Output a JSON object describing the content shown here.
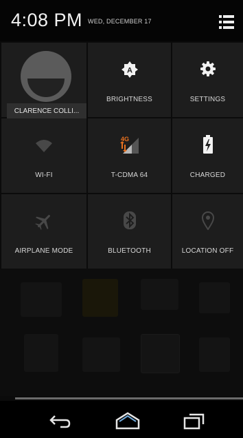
{
  "status": {
    "time": "4:08 PM",
    "date": "WED, DECEMBER 17"
  },
  "header": {
    "menu_icon": "list-menu-icon"
  },
  "tiles": {
    "user": {
      "label": "CLARENCE COLLI...",
      "icon": "avatar"
    },
    "brightness": {
      "label": "BRIGHTNESS",
      "icon": "brightness-auto-icon"
    },
    "settings": {
      "label": "SETTINGS",
      "icon": "gear-icon"
    },
    "wifi": {
      "label": "WI-FI",
      "icon": "wifi-icon"
    },
    "mobile": {
      "label": "T-CDMA 64",
      "icon": "signal-4g-icon",
      "network_type": "4G"
    },
    "battery": {
      "label": "CHARGED",
      "icon": "battery-charging-icon"
    },
    "airplane": {
      "label": "AIRPLANE MODE",
      "icon": "airplane-icon"
    },
    "bluetooth": {
      "label": "BLUETOOTH",
      "icon": "bluetooth-icon"
    },
    "location": {
      "label": "LOCATION OFF",
      "icon": "location-pin-icon"
    }
  },
  "navbar": {
    "back_icon": "back-icon",
    "home_icon": "home-icon",
    "recents_icon": "recents-icon"
  },
  "colors": {
    "accent": "#e8711f",
    "tile_bg": "#1d1d1d",
    "label": "#d8d8d8"
  }
}
